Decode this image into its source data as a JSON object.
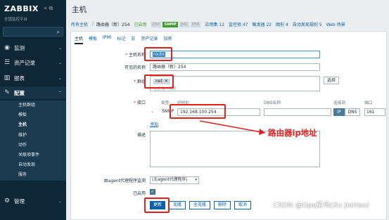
{
  "sidebar": {
    "logo": "ZABBIX",
    "subtitle": "全国监控平台",
    "menu": [
      {
        "icon": "eye-icon",
        "label": "监测"
      },
      {
        "icon": "list-icon",
        "label": "资产记录"
      },
      {
        "icon": "chart-bar-icon",
        "label": "报表"
      },
      {
        "icon": "wrench-icon",
        "label": "配置"
      },
      {
        "icon": "gear-icon",
        "label": "管理"
      }
    ],
    "submenu": [
      "主机群组",
      "模板",
      "主机",
      "维护",
      "动作",
      "关联项事件",
      "自动发现",
      "服务"
    ]
  },
  "header": {
    "title": "主机"
  },
  "breadcrumb": {
    "all_hosts": "所有主机",
    "current": "路由器（新）254",
    "status": "已启用",
    "badges": [
      "ZBX",
      "SNMP",
      "JMX",
      "IPMI"
    ],
    "links": [
      "应用集 12",
      "监控项 47",
      "触发器 22",
      "图形 4",
      "自动发现规则 5",
      "Web 场景"
    ]
  },
  "tabs": [
    "主机",
    "模板",
    "IPMI",
    "标记",
    "宏",
    "资产记录",
    "加密"
  ],
  "form": {
    "hostname_label": "主机名称",
    "hostname_value": "route",
    "visible_name_label": "可见的名称",
    "visible_name_value": "路由器（新）254",
    "groups_label": "群组",
    "group_tag": "net",
    "groups_placeholder": "在此输入搜索",
    "select_button": "选择",
    "interfaces_label": "接口",
    "col_type": "类型",
    "col_ip": "IP地址",
    "col_dns": "DNS名称",
    "col_connect": "连接到",
    "col_port": "端口",
    "iface_type": "SNMP",
    "ip_value": "192.168.100.254",
    "connect_ip": "IP",
    "connect_dns": "DNS",
    "port_value": "161",
    "add_link": "添加",
    "description_label": "描述",
    "proxy_label": "由agent代理程序监测",
    "proxy_value": "(无agent代理程序)",
    "enabled_label": "已启用"
  },
  "buttons": {
    "update": "更新",
    "clone": "克隆",
    "full_clone": "全克隆",
    "delete": "删除",
    "cancel": "取消"
  },
  "annotation": "路由器ip地址",
  "watermark": "CSDN @Ops菜鸟(Xu JieHao)",
  "colors": {
    "sidebar_bg": "#0e2737",
    "accent": "#0c61a6",
    "annotation_red": "#e32020",
    "snmp_green": "#3e9a2a"
  }
}
